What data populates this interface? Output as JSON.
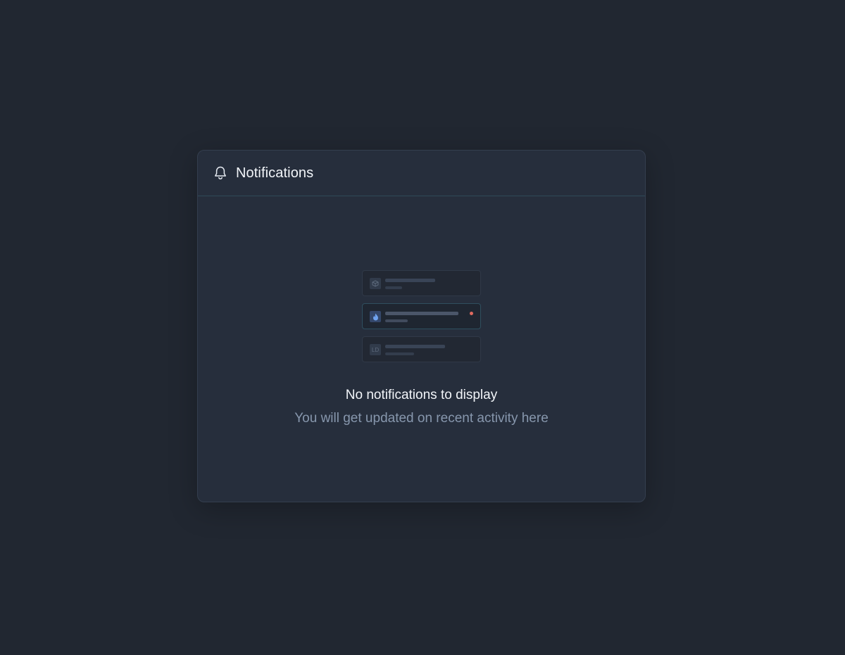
{
  "panel": {
    "title": "Notifications",
    "icon": "bell-icon"
  },
  "illustration": {
    "cards": [
      {
        "avatar_icon": "cube-icon",
        "avatar_text": "",
        "unread": false
      },
      {
        "avatar_icon": "flame-icon",
        "avatar_text": "",
        "unread": true
      },
      {
        "avatar_icon": "",
        "avatar_text": "LD",
        "unread": false
      }
    ],
    "unread_dot_color": "#e06a5f"
  },
  "empty_state": {
    "title": "No notifications to display",
    "subtitle": "You will get updated on recent activity here"
  }
}
